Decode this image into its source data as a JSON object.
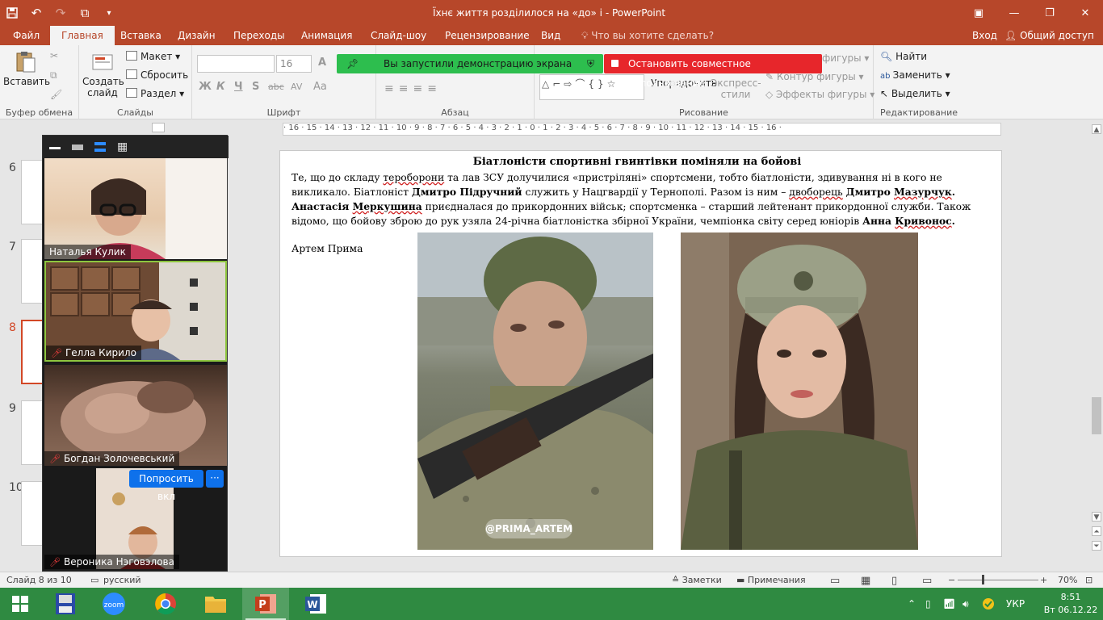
{
  "window": {
    "title": "Їхнє життя розділилося на «до» і - PowerPoint",
    "qat_icons": [
      "save-icon",
      "undo-icon",
      "redo-icon",
      "present-from-start-icon",
      "customize-icon"
    ],
    "controls": [
      "ribbon-display-icon",
      "minimize-icon",
      "restore-icon",
      "close-icon"
    ]
  },
  "tabs": [
    "Файл",
    "Главная",
    "Вставка",
    "Дизайн",
    "Переходы",
    "Анимация",
    "Слайд-шоу",
    "Рецензирование",
    "Вид"
  ],
  "active_tab": "Главная",
  "tell_me": "Что вы хотите сделать?",
  "sign_in": "Вход",
  "share": "Общий доступ",
  "ribbon": {
    "clipboard": {
      "label": "Буфер обмена",
      "paste": "Вставить"
    },
    "slides": {
      "label": "Слайды",
      "new_slide": "Создать слайд",
      "layout": "Макет",
      "reset": "Сбросить",
      "section": "Раздел"
    },
    "font": {
      "label": "Шрифт",
      "font_size": "16",
      "buttons": [
        "Ж",
        "К",
        "Ч",
        "S",
        "abc",
        "AV",
        "Aa"
      ]
    },
    "paragraph": {
      "label": "Абзац"
    },
    "drawing": {
      "label": "Рисование",
      "arrange": "Упорядочить",
      "quick_styles": "Экспресс-стили",
      "shape_fill": "фигуры",
      "shape_outline": "Контур фигуры",
      "shape_effects": "Эффекты фигуры"
    },
    "editing": {
      "label": "Редактирование",
      "find": "Найти",
      "replace": "Заменить",
      "select": "Выделить"
    }
  },
  "zoom_banner": {
    "sharing": "Вы запустили демонстрацию экрана",
    "stop": "Остановить совместное использование"
  },
  "slide_numbers": [
    "6",
    "7",
    "8",
    "9",
    "10"
  ],
  "ruler_text": "· 16 · 15 · 14 · 13 · 12 · 11 · 10 · 9 · 8 · 7 · 6 · 5 · 4 · 3 · 2 · 1 · 0 · 1 · 2 · 3 · 4 · 5 · 6 · 7 · 8 · 9 · 10 · 11 · 12 · 13 · 14 · 15 · 16 ·",
  "slide": {
    "heading": "Біатлоністи  спортивні гвинтівки поміняли на бойові",
    "caption": "Артем Прима",
    "watermark": "@PRIMA_ARTEM"
  },
  "zoom": {
    "participants": [
      {
        "name": "Наталья Кулик",
        "muted": false
      },
      {
        "name": "Гелла Кирило",
        "muted": true
      },
      {
        "name": "Богдан Золочевський",
        "muted": true
      },
      {
        "name": "Вероника Нэговэлова",
        "muted": true
      }
    ],
    "ask_button": "Попросить вкл",
    "more_button": "···"
  },
  "status": {
    "slide_info": "Слайд 8 из 10",
    "language": "русский",
    "notes": "Заметки",
    "comments": "Примечания",
    "zoom": "70%"
  },
  "taskbar": {
    "apps": [
      "windows-start-icon",
      "drive-icon",
      "zoom-app-icon",
      "chrome-icon",
      "file-explorer-icon",
      "powerpoint-icon",
      "word-icon"
    ],
    "lang": "УКР",
    "time": "8:51",
    "date": "Вт 06.12.22"
  }
}
